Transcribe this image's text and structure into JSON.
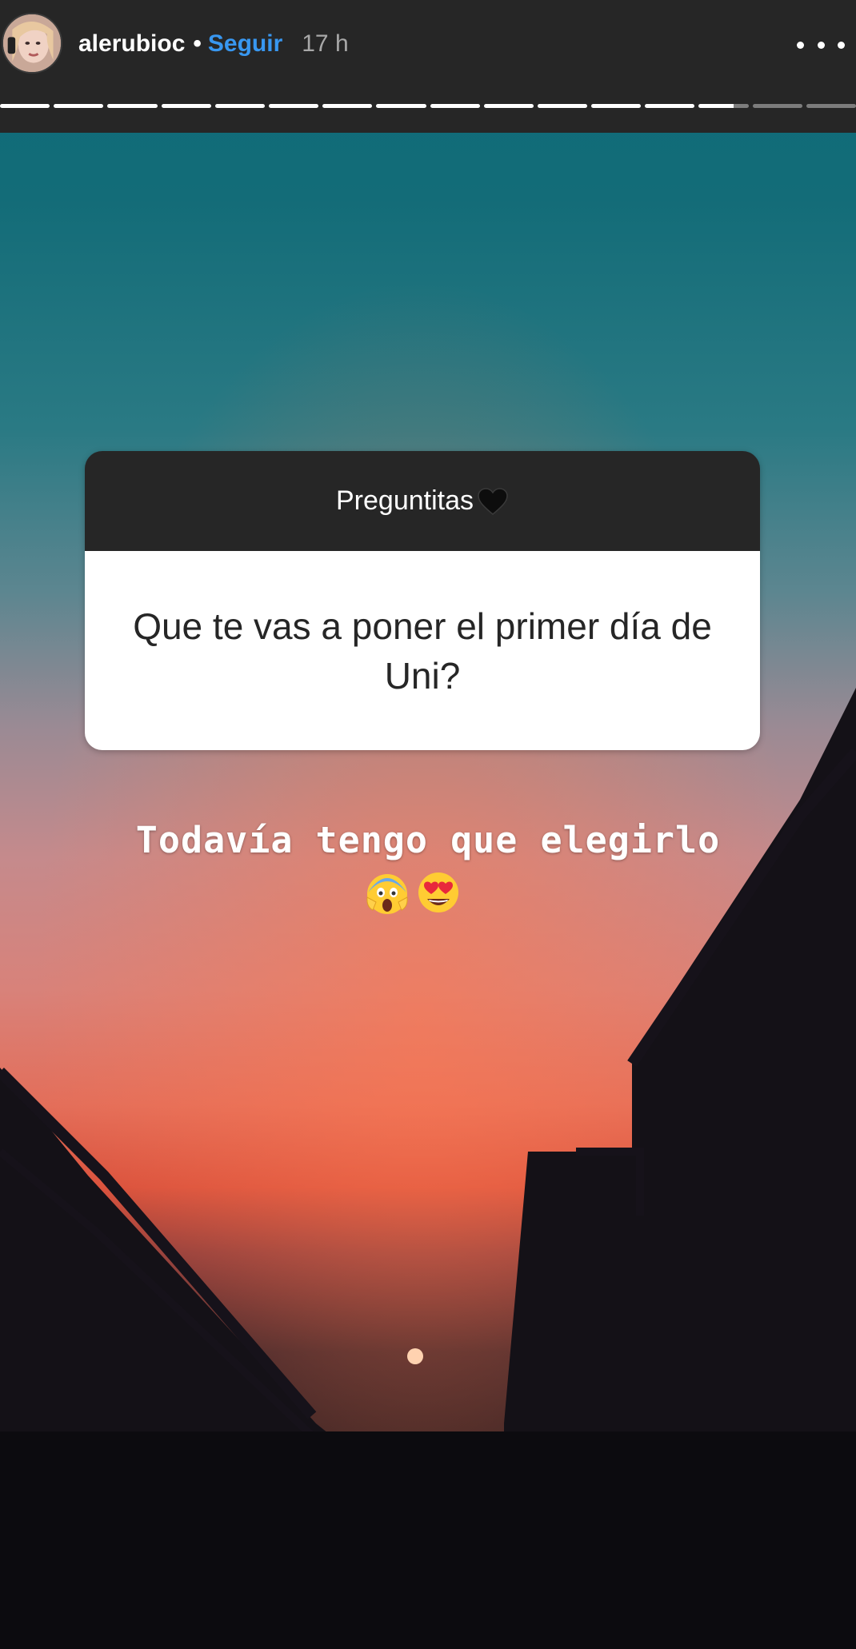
{
  "header": {
    "username": "alerubioc",
    "separator": "•",
    "follow_label": "Seguir",
    "time": "17 h",
    "progress_segments": 16,
    "progress_current": 14
  },
  "question": {
    "title": "Preguntitas",
    "title_icon": "black-heart-emoji",
    "text": "Que te vas a poner el primer día de Uni?"
  },
  "answer": {
    "text": "Todavía tengo que elegirlo",
    "emoji_icons": [
      "screaming-face-emoji",
      "heart-eyes-emoji"
    ]
  },
  "colors": {
    "header_bg": "#262626",
    "follow": "#3897f0",
    "sky_top": "#0c6a7a",
    "sky_horizon": "#e66848"
  }
}
